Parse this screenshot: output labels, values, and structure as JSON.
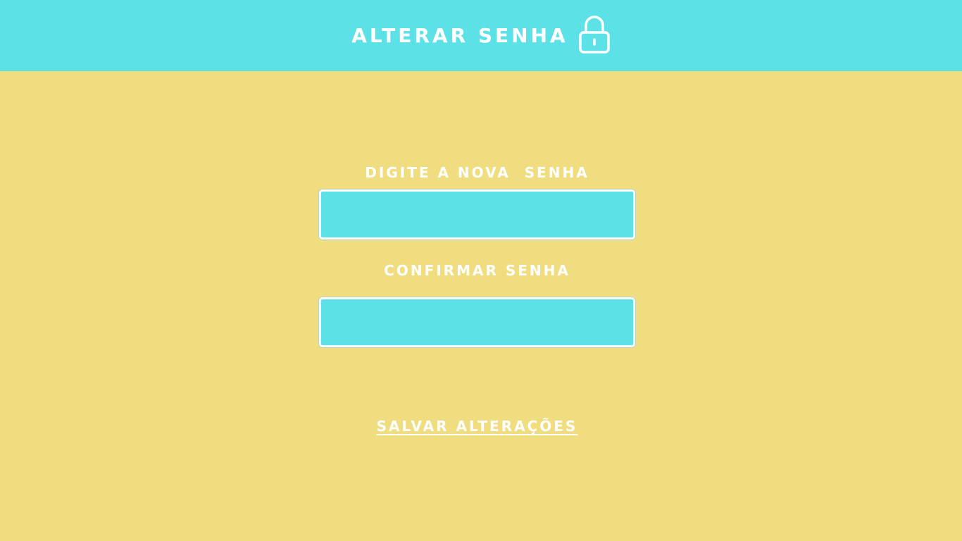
{
  "header": {
    "title": "ALTERAR SENHA",
    "icon": "lock-icon"
  },
  "form": {
    "new_password_label": "DIGITE A NOVA  SENHA",
    "new_password_value": "",
    "confirm_password_label": "CONFIRMAR SENHA",
    "confirm_password_value": "",
    "save_label": "SALVAR ALTERAÇÕES"
  },
  "colors": {
    "background": "#f0dd80",
    "accent": "#5ce1e6",
    "text": "#ffffff"
  }
}
